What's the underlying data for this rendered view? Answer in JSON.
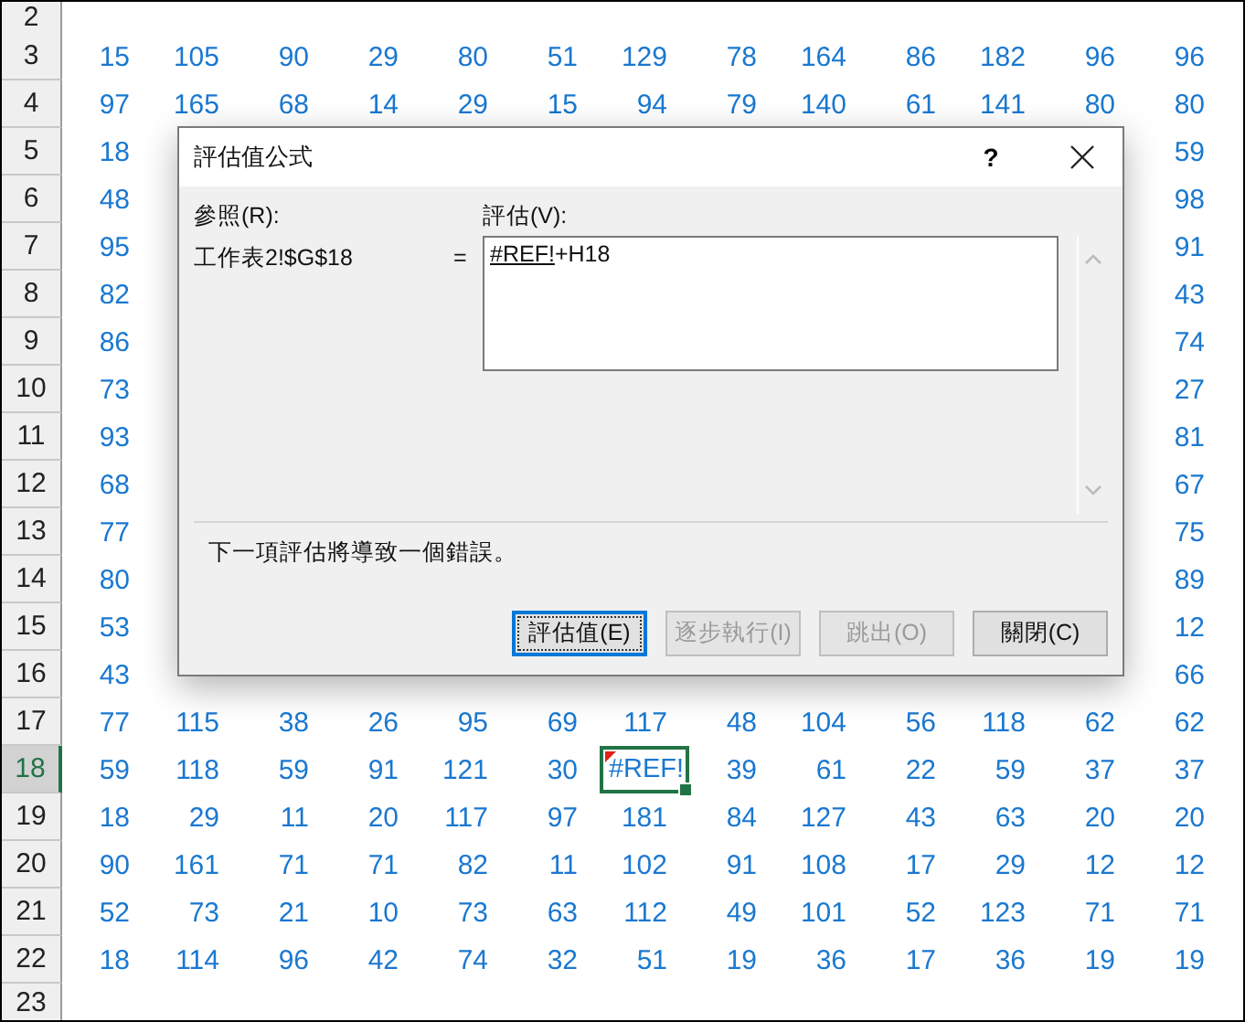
{
  "sheet": {
    "rows": [
      {
        "header": "2",
        "selected": false,
        "cells": []
      },
      {
        "header": "3",
        "selected": false,
        "cells": [
          {
            "text": "15",
            "selected": false,
            "flagged": false
          },
          {
            "text": "105",
            "selected": false,
            "flagged": false
          },
          {
            "text": "90",
            "selected": false,
            "flagged": false
          },
          {
            "text": "29",
            "selected": false,
            "flagged": false
          },
          {
            "text": "80",
            "selected": false,
            "flagged": false
          },
          {
            "text": "51",
            "selected": false,
            "flagged": false
          },
          {
            "text": "129",
            "selected": false,
            "flagged": false
          },
          {
            "text": "78",
            "selected": false,
            "flagged": false
          },
          {
            "text": "164",
            "selected": false,
            "flagged": false
          },
          {
            "text": "86",
            "selected": false,
            "flagged": false
          },
          {
            "text": "182",
            "selected": false,
            "flagged": false
          },
          {
            "text": "96",
            "selected": false,
            "flagged": false
          },
          {
            "text": "96",
            "selected": false,
            "flagged": false
          }
        ]
      },
      {
        "header": "4",
        "selected": false,
        "cells": [
          {
            "text": "97",
            "selected": false,
            "flagged": false
          },
          {
            "text": "165",
            "selected": false,
            "flagged": false
          },
          {
            "text": "68",
            "selected": false,
            "flagged": false
          },
          {
            "text": "14",
            "selected": false,
            "flagged": false
          },
          {
            "text": "29",
            "selected": false,
            "flagged": false
          },
          {
            "text": "15",
            "selected": false,
            "flagged": false
          },
          {
            "text": "94",
            "selected": false,
            "flagged": false
          },
          {
            "text": "79",
            "selected": false,
            "flagged": false
          },
          {
            "text": "140",
            "selected": false,
            "flagged": false
          },
          {
            "text": "61",
            "selected": false,
            "flagged": false
          },
          {
            "text": "141",
            "selected": false,
            "flagged": false
          },
          {
            "text": "80",
            "selected": false,
            "flagged": false
          },
          {
            "text": "80",
            "selected": false,
            "flagged": false
          }
        ]
      },
      {
        "header": "5",
        "selected": false,
        "cells": [
          {
            "text": "18",
            "selected": false,
            "flagged": false
          },
          null,
          null,
          null,
          null,
          null,
          null,
          null,
          null,
          null,
          null,
          null,
          {
            "text": "59",
            "selected": false,
            "flagged": false
          }
        ]
      },
      {
        "header": "6",
        "selected": false,
        "cells": [
          {
            "text": "48",
            "selected": false,
            "flagged": false
          },
          null,
          null,
          null,
          null,
          null,
          null,
          null,
          null,
          null,
          null,
          null,
          {
            "text": "98",
            "selected": false,
            "flagged": false
          }
        ]
      },
      {
        "header": "7",
        "selected": false,
        "cells": [
          {
            "text": "95",
            "selected": false,
            "flagged": false
          },
          null,
          null,
          null,
          null,
          null,
          null,
          null,
          null,
          null,
          null,
          null,
          {
            "text": "91",
            "selected": false,
            "flagged": false
          }
        ]
      },
      {
        "header": "8",
        "selected": false,
        "cells": [
          {
            "text": "82",
            "selected": false,
            "flagged": false
          },
          null,
          null,
          null,
          null,
          null,
          null,
          null,
          null,
          null,
          null,
          null,
          {
            "text": "43",
            "selected": false,
            "flagged": false
          }
        ]
      },
      {
        "header": "9",
        "selected": false,
        "cells": [
          {
            "text": "86",
            "selected": false,
            "flagged": false
          },
          null,
          null,
          null,
          null,
          null,
          null,
          null,
          null,
          null,
          null,
          null,
          {
            "text": "74",
            "selected": false,
            "flagged": false
          }
        ]
      },
      {
        "header": "10",
        "selected": false,
        "cells": [
          {
            "text": "73",
            "selected": false,
            "flagged": false
          },
          null,
          null,
          null,
          null,
          null,
          null,
          null,
          null,
          null,
          null,
          null,
          {
            "text": "27",
            "selected": false,
            "flagged": false
          }
        ]
      },
      {
        "header": "11",
        "selected": false,
        "cells": [
          {
            "text": "93",
            "selected": false,
            "flagged": false
          },
          null,
          null,
          null,
          null,
          null,
          null,
          null,
          null,
          null,
          null,
          null,
          {
            "text": "81",
            "selected": false,
            "flagged": false
          }
        ]
      },
      {
        "header": "12",
        "selected": false,
        "cells": [
          {
            "text": "68",
            "selected": false,
            "flagged": false
          },
          null,
          null,
          null,
          null,
          null,
          null,
          null,
          null,
          null,
          null,
          null,
          {
            "text": "67",
            "selected": false,
            "flagged": false
          }
        ]
      },
      {
        "header": "13",
        "selected": false,
        "cells": [
          {
            "text": "77",
            "selected": false,
            "flagged": false
          },
          null,
          null,
          null,
          null,
          null,
          null,
          null,
          null,
          null,
          null,
          null,
          {
            "text": "75",
            "selected": false,
            "flagged": false
          }
        ]
      },
      {
        "header": "14",
        "selected": false,
        "cells": [
          {
            "text": "80",
            "selected": false,
            "flagged": false
          },
          null,
          null,
          null,
          null,
          null,
          null,
          null,
          null,
          null,
          null,
          null,
          {
            "text": "89",
            "selected": false,
            "flagged": false
          }
        ]
      },
      {
        "header": "15",
        "selected": false,
        "cells": [
          {
            "text": "53",
            "selected": false,
            "flagged": false
          },
          null,
          null,
          null,
          null,
          null,
          null,
          null,
          null,
          null,
          null,
          null,
          {
            "text": "12",
            "selected": false,
            "flagged": false
          }
        ]
      },
      {
        "header": "16",
        "selected": false,
        "cells": [
          {
            "text": "43",
            "selected": false,
            "flagged": false
          },
          null,
          null,
          null,
          null,
          null,
          null,
          null,
          null,
          null,
          null,
          null,
          {
            "text": "66",
            "selected": false,
            "flagged": false
          }
        ]
      },
      {
        "header": "17",
        "selected": false,
        "cells": [
          {
            "text": "77",
            "selected": false,
            "flagged": false
          },
          {
            "text": "115",
            "selected": false,
            "flagged": false
          },
          {
            "text": "38",
            "selected": false,
            "flagged": false
          },
          {
            "text": "26",
            "selected": false,
            "flagged": false
          },
          {
            "text": "95",
            "selected": false,
            "flagged": false
          },
          {
            "text": "69",
            "selected": false,
            "flagged": false
          },
          {
            "text": "117",
            "selected": false,
            "flagged": false
          },
          {
            "text": "48",
            "selected": false,
            "flagged": false
          },
          {
            "text": "104",
            "selected": false,
            "flagged": false
          },
          {
            "text": "56",
            "selected": false,
            "flagged": false
          },
          {
            "text": "118",
            "selected": false,
            "flagged": false
          },
          {
            "text": "62",
            "selected": false,
            "flagged": false
          },
          {
            "text": "62",
            "selected": false,
            "flagged": false
          }
        ]
      },
      {
        "header": "18",
        "selected": true,
        "cells": [
          {
            "text": "59",
            "selected": false,
            "flagged": false
          },
          {
            "text": "118",
            "selected": false,
            "flagged": false
          },
          {
            "text": "59",
            "selected": false,
            "flagged": false
          },
          {
            "text": "91",
            "selected": false,
            "flagged": false
          },
          {
            "text": "121",
            "selected": false,
            "flagged": false
          },
          {
            "text": "30",
            "selected": false,
            "flagged": false
          },
          {
            "text": "#REF!",
            "selected": true,
            "flagged": true
          },
          {
            "text": "39",
            "selected": false,
            "flagged": false
          },
          {
            "text": "61",
            "selected": false,
            "flagged": false
          },
          {
            "text": "22",
            "selected": false,
            "flagged": false
          },
          {
            "text": "59",
            "selected": false,
            "flagged": false
          },
          {
            "text": "37",
            "selected": false,
            "flagged": false
          },
          {
            "text": "37",
            "selected": false,
            "flagged": false
          }
        ]
      },
      {
        "header": "19",
        "selected": false,
        "cells": [
          {
            "text": "18",
            "selected": false,
            "flagged": false
          },
          {
            "text": "29",
            "selected": false,
            "flagged": false
          },
          {
            "text": "11",
            "selected": false,
            "flagged": false
          },
          {
            "text": "20",
            "selected": false,
            "flagged": false
          },
          {
            "text": "117",
            "selected": false,
            "flagged": false
          },
          {
            "text": "97",
            "selected": false,
            "flagged": false
          },
          {
            "text": "181",
            "selected": false,
            "flagged": false
          },
          {
            "text": "84",
            "selected": false,
            "flagged": false
          },
          {
            "text": "127",
            "selected": false,
            "flagged": false
          },
          {
            "text": "43",
            "selected": false,
            "flagged": false
          },
          {
            "text": "63",
            "selected": false,
            "flagged": false
          },
          {
            "text": "20",
            "selected": false,
            "flagged": false
          },
          {
            "text": "20",
            "selected": false,
            "flagged": false
          }
        ]
      },
      {
        "header": "20",
        "selected": false,
        "cells": [
          {
            "text": "90",
            "selected": false,
            "flagged": false
          },
          {
            "text": "161",
            "selected": false,
            "flagged": false
          },
          {
            "text": "71",
            "selected": false,
            "flagged": false
          },
          {
            "text": "71",
            "selected": false,
            "flagged": false
          },
          {
            "text": "82",
            "selected": false,
            "flagged": false
          },
          {
            "text": "11",
            "selected": false,
            "flagged": false
          },
          {
            "text": "102",
            "selected": false,
            "flagged": false
          },
          {
            "text": "91",
            "selected": false,
            "flagged": false
          },
          {
            "text": "108",
            "selected": false,
            "flagged": false
          },
          {
            "text": "17",
            "selected": false,
            "flagged": false
          },
          {
            "text": "29",
            "selected": false,
            "flagged": false
          },
          {
            "text": "12",
            "selected": false,
            "flagged": false
          },
          {
            "text": "12",
            "selected": false,
            "flagged": false
          }
        ]
      },
      {
        "header": "21",
        "selected": false,
        "cells": [
          {
            "text": "52",
            "selected": false,
            "flagged": false
          },
          {
            "text": "73",
            "selected": false,
            "flagged": false
          },
          {
            "text": "21",
            "selected": false,
            "flagged": false
          },
          {
            "text": "10",
            "selected": false,
            "flagged": false
          },
          {
            "text": "73",
            "selected": false,
            "flagged": false
          },
          {
            "text": "63",
            "selected": false,
            "flagged": false
          },
          {
            "text": "112",
            "selected": false,
            "flagged": false
          },
          {
            "text": "49",
            "selected": false,
            "flagged": false
          },
          {
            "text": "101",
            "selected": false,
            "flagged": false
          },
          {
            "text": "52",
            "selected": false,
            "flagged": false
          },
          {
            "text": "123",
            "selected": false,
            "flagged": false
          },
          {
            "text": "71",
            "selected": false,
            "flagged": false
          },
          {
            "text": "71",
            "selected": false,
            "flagged": false
          }
        ]
      },
      {
        "header": "22",
        "selected": false,
        "cells": [
          {
            "text": "18",
            "selected": false,
            "flagged": false
          },
          {
            "text": "114",
            "selected": false,
            "flagged": false
          },
          {
            "text": "96",
            "selected": false,
            "flagged": false
          },
          {
            "text": "42",
            "selected": false,
            "flagged": false
          },
          {
            "text": "74",
            "selected": false,
            "flagged": false
          },
          {
            "text": "32",
            "selected": false,
            "flagged": false
          },
          {
            "text": "51",
            "selected": false,
            "flagged": false
          },
          {
            "text": "19",
            "selected": false,
            "flagged": false
          },
          {
            "text": "36",
            "selected": false,
            "flagged": false
          },
          {
            "text": "17",
            "selected": false,
            "flagged": false
          },
          {
            "text": "36",
            "selected": false,
            "flagged": false
          },
          {
            "text": "19",
            "selected": false,
            "flagged": false
          },
          {
            "text": "19",
            "selected": false,
            "flagged": false
          }
        ]
      },
      {
        "header": "23",
        "selected": false,
        "cells": []
      }
    ]
  },
  "dialog": {
    "title": "評估值公式",
    "help": "?",
    "reference_label": "參照(R):",
    "reference": "工作表2!$G$18",
    "equals": "=",
    "evaluation_label": "評估(V):",
    "expression": [
      {
        "text": "#REF!",
        "underlined": true
      },
      {
        "text": "+H18",
        "underlined": false
      }
    ],
    "message": "下一項評估將導致一個錯誤。",
    "buttons": [
      {
        "label": "評估值(E)",
        "disabled": false,
        "focused": true
      },
      {
        "label": "逐步執行(I)",
        "disabled": true,
        "focused": false
      },
      {
        "label": "跳出(O)",
        "disabled": true,
        "focused": false
      },
      {
        "label": "關閉(C)",
        "disabled": false,
        "focused": false
      }
    ]
  }
}
